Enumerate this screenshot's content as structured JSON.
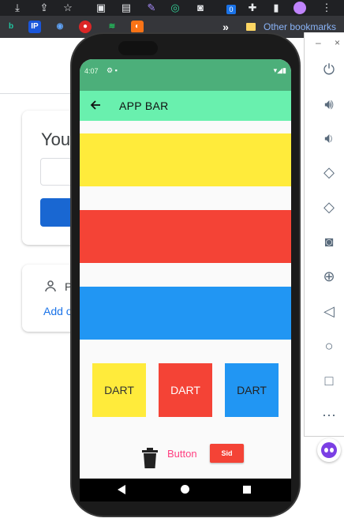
{
  "browser": {
    "bookmarks": {
      "overflow_label": "»",
      "other_bookmarks": "Other bookmarks",
      "ip_label": "IP"
    },
    "extension_badge": "0"
  },
  "background_page": {
    "card1_title": "Your",
    "card2_label": "P",
    "card2_link": "Add o"
  },
  "phone": {
    "status_bar": {
      "time": "4:07"
    },
    "app_bar": {
      "title": "APP BAR",
      "back_icon": "arrow-back-icon",
      "color": "#69f0ae"
    },
    "bands": [
      {
        "color": "#ffeb3b"
      },
      {
        "color": "#f44336"
      },
      {
        "color": "#2196f3"
      }
    ],
    "dart_boxes": [
      {
        "label": "DART",
        "color": "#ffeb3b"
      },
      {
        "label": "DART",
        "color": "#f44336"
      },
      {
        "label": "DART",
        "color": "#2196f3"
      }
    ],
    "actions": {
      "delete_icon": "trash-icon",
      "text_button": "Button",
      "raised_button": "Sid"
    }
  },
  "emulator_panel": {
    "icons": [
      "power-icon",
      "volume-up-icon",
      "volume-down-icon",
      "rotate-left-icon",
      "rotate-right-icon",
      "camera-icon",
      "zoom-icon",
      "back-icon",
      "home-icon",
      "overview-icon",
      "more-icon"
    ]
  }
}
